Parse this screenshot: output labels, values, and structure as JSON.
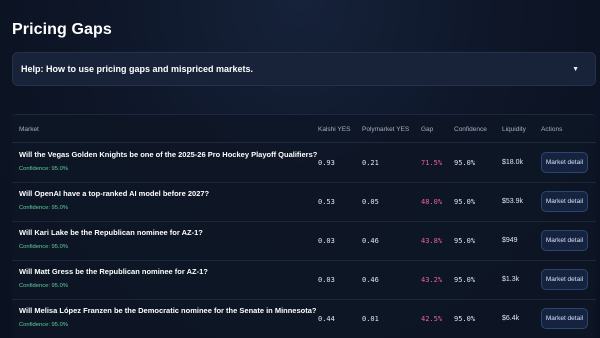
{
  "page": {
    "title": "Pricing Gaps"
  },
  "help": {
    "label": "Help: How to use pricing gaps and mispriced markets.",
    "caret": "▼"
  },
  "table": {
    "headers": {
      "market": "Market",
      "kalshi": "Kalshi YES",
      "polymarket": "Polymarket YES",
      "gap": "Gap",
      "confidence": "Confidence",
      "liquidity": "Liquidity",
      "actions": "Actions"
    },
    "rows": [
      {
        "question": "Will the Vegas Golden Knights be one of the 2025-26 Pro Hockey Playoff Qualifiers?",
        "confidence_sub": "Confidence: 95.0%",
        "kalshi": "0.93",
        "polymarket": "0.21",
        "gap": "71.5%",
        "confidence": "95.0%",
        "liquidity": "$18.0k",
        "action": "Market detail"
      },
      {
        "question": "Will OpenAI have a top-ranked AI model before 2027?",
        "confidence_sub": "Confidence: 95.0%",
        "kalshi": "0.53",
        "polymarket": "0.05",
        "gap": "48.0%",
        "confidence": "95.0%",
        "liquidity": "$53.9k",
        "action": "Market detail"
      },
      {
        "question": "Will Kari Lake be the Republican nominee for AZ-1?",
        "confidence_sub": "Confidence: 95.0%",
        "kalshi": "0.03",
        "polymarket": "0.46",
        "gap": "43.8%",
        "confidence": "95.0%",
        "liquidity": "$949",
        "action": "Market detail"
      },
      {
        "question": "Will Matt Gress be the Republican nominee for AZ-1?",
        "confidence_sub": "Confidence: 95.0%",
        "kalshi": "0.03",
        "polymarket": "0.46",
        "gap": "43.2%",
        "confidence": "95.0%",
        "liquidity": "$1.3k",
        "action": "Market detail"
      },
      {
        "question": "Will Melisa López Franzen be the Democratic nominee for the Senate in Minnesota?",
        "confidence_sub": "Confidence: 95.0%",
        "kalshi": "0.44",
        "polymarket": "0.01",
        "gap": "42.5%",
        "confidence": "95.0%",
        "liquidity": "$6.4k",
        "action": "Market detail"
      }
    ]
  },
  "colors": {
    "gap": "#ec5fa0",
    "confidence_sub": "#5fcf9f",
    "background": "#0d1526"
  }
}
